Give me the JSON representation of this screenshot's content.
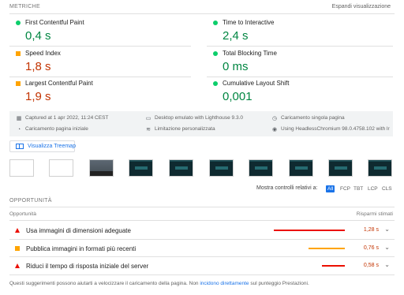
{
  "header": {
    "section_label": "METRICHE",
    "expand_label": "Espandi visualizzazione"
  },
  "metrics": {
    "fcp": {
      "label": "First Contentful Paint",
      "value": "0,4 s",
      "rating": "green"
    },
    "tti": {
      "label": "Time to Interactive",
      "value": "2,4 s",
      "rating": "green"
    },
    "si": {
      "label": "Speed Index",
      "value": "1,8 s",
      "rating": "orange"
    },
    "tbt": {
      "label": "Total Blocking Time",
      "value": "0 ms",
      "rating": "green"
    },
    "lcp": {
      "label": "Largest Contentful Paint",
      "value": "1,9 s",
      "rating": "orange"
    },
    "cls": {
      "label": "Cumulative Layout Shift",
      "value": "0,001",
      "rating": "green"
    }
  },
  "info": {
    "captured": "Captured at 1 apr 2022, 11:24 CEST",
    "device": "Desktop emulato with Lighthouse 9.3.0",
    "single_page": "Caricamento singola pagina",
    "initial_load": "Caricamento pagina iniziale",
    "throttling": "Limitazione personalizzata",
    "browser": "Using HeadlessChromium 98.0.4758.102 with lr"
  },
  "treemap_button": "Visualizza Treemap",
  "controls": {
    "label": "Mostra controlli relativi a:",
    "items": [
      "All",
      "FCP",
      "TBT",
      "LCP",
      "CLS"
    ],
    "active": "All"
  },
  "opportunities": {
    "title": "OPPORTUNITÀ",
    "col_left": "Opportunità",
    "col_right": "Risparmi stimati",
    "rows": [
      {
        "label": "Usa immagini di dimensioni adeguate",
        "value": "1,28 s",
        "severity": "red",
        "fraction": 1.0
      },
      {
        "label": "Pubblica immagini in formati più recenti",
        "value": "0,76 s",
        "severity": "orange",
        "fraction": 0.59
      },
      {
        "label": "Riduci il tempo di risposta iniziale del server",
        "value": "0,58 s",
        "severity": "red",
        "fraction": 0.45
      }
    ]
  },
  "footnote": {
    "before": "Questi suggerimenti possono aiutarti a velocizzare il caricamento della pagina. Non",
    "link": "incidono direttamente",
    "after": "sul punteggio Prestazioni."
  },
  "colors": {
    "green": "#0cce6b",
    "orange": "#ffa400",
    "red": "#eb0f00",
    "accent": "#1a73e8"
  }
}
